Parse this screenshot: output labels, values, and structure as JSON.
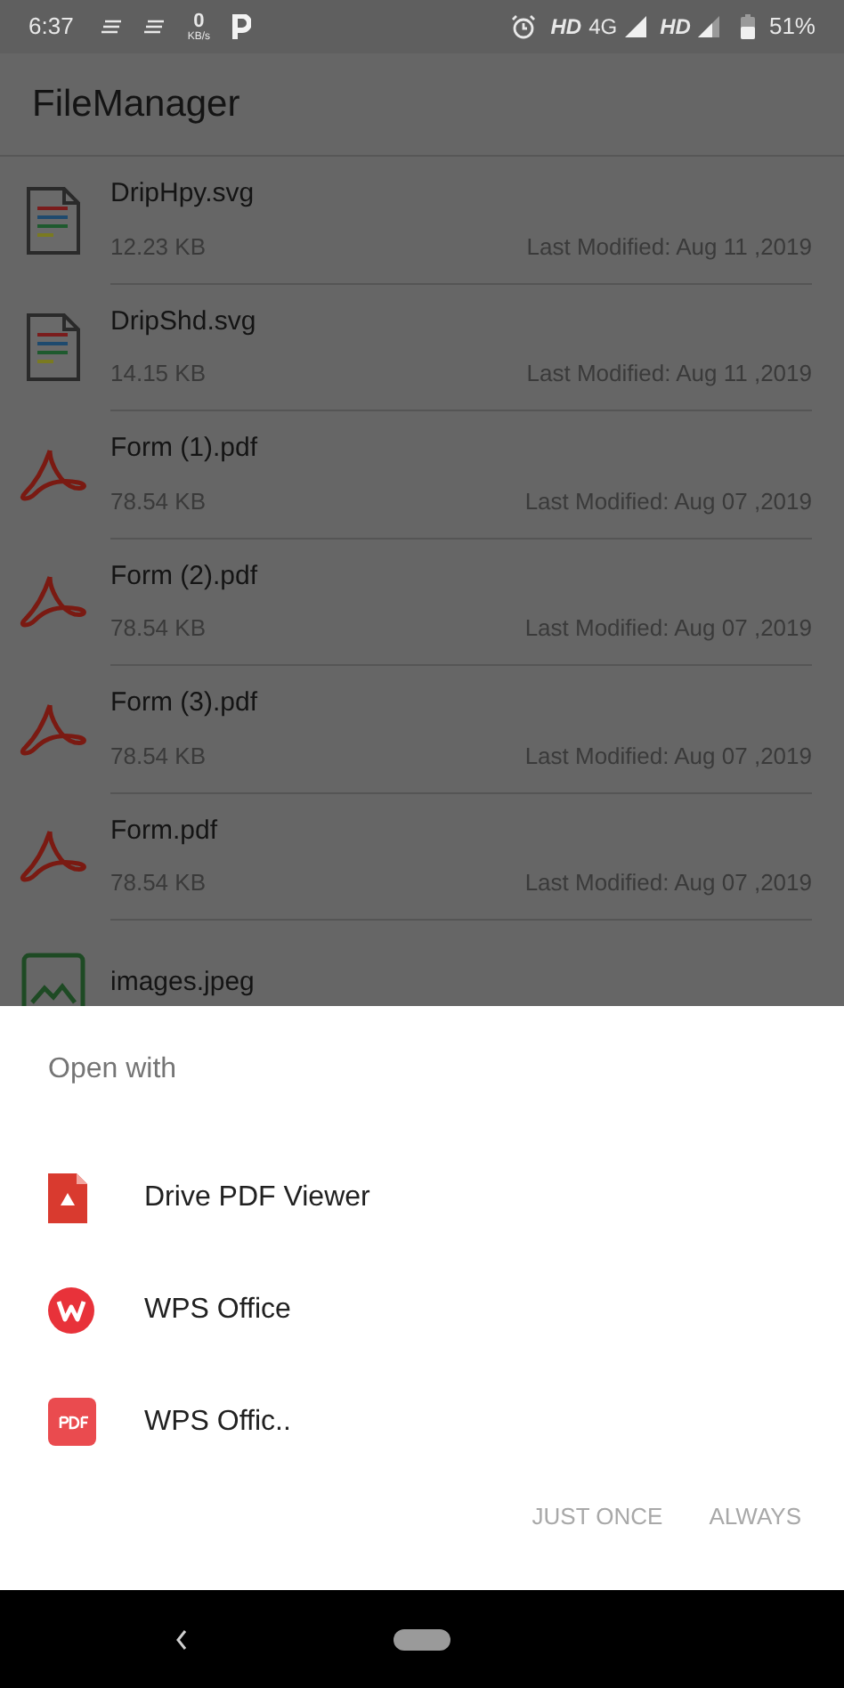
{
  "status_bar": {
    "time": "6:37",
    "speed_value": "0",
    "speed_unit": "KB/s",
    "network_1": "HD",
    "network_1_type": "4G",
    "network_2": "HD",
    "battery": "51%"
  },
  "app_bar": {
    "title": "FileManager"
  },
  "files": [
    {
      "name": "DripHpy.svg",
      "size": "12.23 KB",
      "modified": "Last Modified: Aug 11 ,2019",
      "kind": "svg"
    },
    {
      "name": "DripShd.svg",
      "size": "14.15 KB",
      "modified": "Last Modified: Aug 11 ,2019",
      "kind": "svg"
    },
    {
      "name": "Form (1).pdf",
      "size": "78.54 KB",
      "modified": "Last Modified: Aug 07 ,2019",
      "kind": "pdf"
    },
    {
      "name": "Form (2).pdf",
      "size": "78.54 KB",
      "modified": "Last Modified: Aug 07 ,2019",
      "kind": "pdf"
    },
    {
      "name": "Form (3).pdf",
      "size": "78.54 KB",
      "modified": "Last Modified: Aug 07 ,2019",
      "kind": "pdf"
    },
    {
      "name": "Form.pdf",
      "size": "78.54 KB",
      "modified": "Last Modified: Aug 07 ,2019",
      "kind": "pdf"
    },
    {
      "name": "images.jpeg",
      "kind": "image"
    }
  ],
  "open_with": {
    "title": "Open with",
    "apps": [
      {
        "label": "Drive PDF Viewer",
        "kind": "drive"
      },
      {
        "label": "WPS Office",
        "kind": "wps"
      },
      {
        "label": "WPS Offic..",
        "kind": "pdf"
      }
    ],
    "buttons": [
      {
        "label": "JUST ONCE",
        "disabled": true
      },
      {
        "label": "ALWAYS",
        "disabled": true
      }
    ]
  }
}
